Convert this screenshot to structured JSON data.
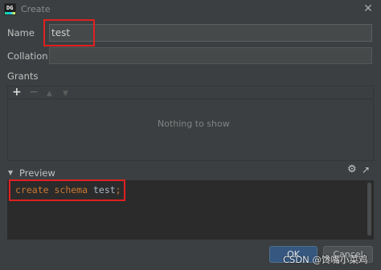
{
  "window": {
    "title": "Create",
    "close_icon": "close-icon",
    "app_icon": "datagrip-icon",
    "app_icon_text": "DG"
  },
  "form": {
    "name_label": "Name",
    "name_value": "test",
    "collation_label": "Collation",
    "collation_value": ""
  },
  "grants": {
    "label": "Grants",
    "toolbar": {
      "add": "+",
      "remove": "−",
      "up": "▲",
      "down": "▼"
    },
    "empty_text": "Nothing to show"
  },
  "preview": {
    "toggle": "▼",
    "label": "Preview",
    "settings_icon": "⚙",
    "open_icon": "↗",
    "code": {
      "kw1": "create",
      "kw2": "schema",
      "ident": "test",
      "semi": ";"
    }
  },
  "buttons": {
    "ok": "OK",
    "cancel": "Cancel"
  },
  "watermark": "CSDN @馋嘴小菜鸡",
  "colors": {
    "keyword": "#cc7832",
    "identifier": "#a9b7c6",
    "highlight": "#e02020",
    "ok_button": "#365880"
  }
}
